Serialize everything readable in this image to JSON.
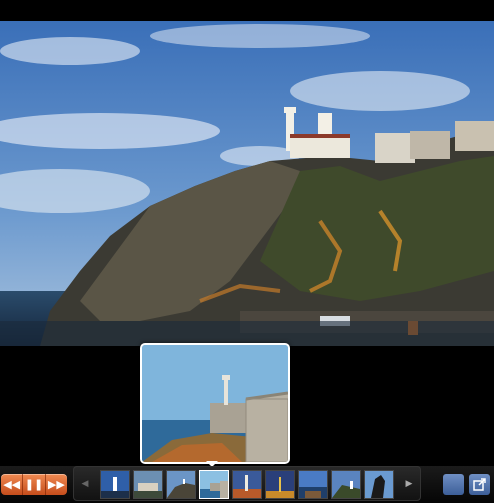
{
  "slideshow": {
    "main_image_icon": "photo-coastal-lighthouse-cliff",
    "preview_icon": "photo-lighthouse-castle-wall",
    "controls": {
      "previous_icon": "rewind-icon",
      "pause_icon": "pause-icon",
      "next_icon": "fast-forward-icon"
    },
    "thumbnail_strip": {
      "left_arrow_icon": "arrow-left-icon",
      "right_arrow_icon": "arrow-right-icon",
      "thumbnails": [
        {
          "icon": "thumb-lighthouse-blue"
        },
        {
          "icon": "thumb-coast-buildings"
        },
        {
          "icon": "thumb-main-cliff"
        },
        {
          "icon": "thumb-castle-wall"
        },
        {
          "icon": "thumb-lighthouse-sunset"
        },
        {
          "icon": "thumb-tower-dusk"
        },
        {
          "icon": "thumb-sea-horizon"
        },
        {
          "icon": "thumb-lighthouse-hill"
        },
        {
          "icon": "thumb-shadow-tree"
        }
      ],
      "active_index": 3
    },
    "right_buttons": {
      "grid_icon": "grid-view-icon",
      "popout_icon": "popout-icon"
    },
    "colors": {
      "control_orange": "#e06a33",
      "accent_blue": "#5577b0",
      "background": "#000000"
    }
  }
}
